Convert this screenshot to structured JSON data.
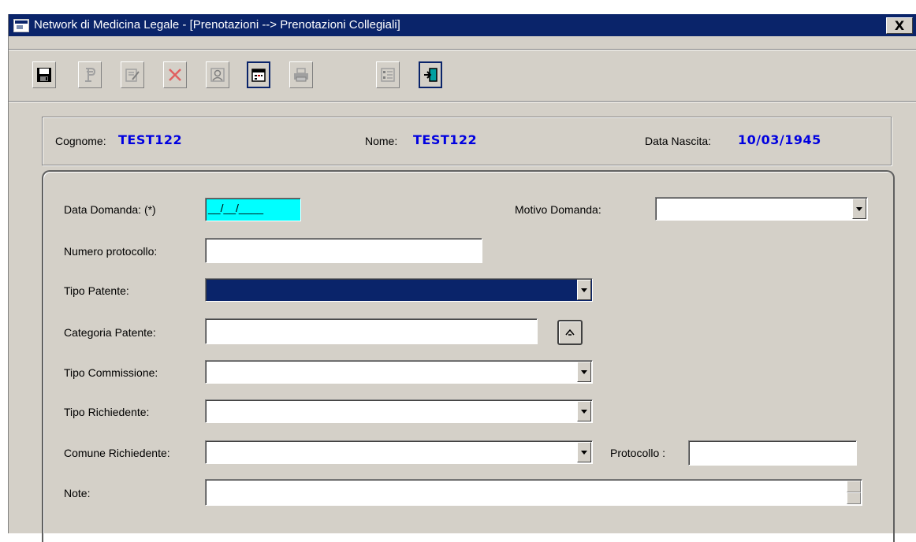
{
  "window": {
    "title": "Network di Medicina Legale - [Prenotazioni --> Prenotazioni Collegiali]",
    "close_label": "X",
    "title_color": "#0a246a"
  },
  "toolbar": {
    "buttons": [
      {
        "name": "save",
        "icon": "floppy-disk-icon",
        "enabled": true
      },
      {
        "name": "p",
        "icon": "p-letter-icon",
        "enabled": false
      },
      {
        "name": "edit",
        "icon": "edit-document-icon",
        "enabled": false
      },
      {
        "name": "delete",
        "icon": "red-x-icon",
        "enabled": false
      },
      {
        "name": "person",
        "icon": "person-card-icon",
        "enabled": false
      },
      {
        "name": "calendar",
        "icon": "calendar-icon",
        "enabled": true
      },
      {
        "name": "print",
        "icon": "printer-icon",
        "enabled": false
      },
      {
        "name": "list",
        "icon": "list-form-icon",
        "enabled": false
      },
      {
        "name": "exit",
        "icon": "exit-door-icon",
        "enabled": true
      }
    ]
  },
  "patient": {
    "cognome_label": "Cognome:",
    "cognome_value": "TEST122",
    "nome_label": "Nome:",
    "nome_value": "TEST122",
    "nascita_label": "Data Nascita:",
    "nascita_value": "10/03/1945",
    "value_color": "#0000e0"
  },
  "form": {
    "data_domanda_label": "Data Domanda: (*)",
    "data_domanda_value": "__/__/____",
    "motivo_label": "Motivo Domanda:",
    "motivo_value": "",
    "numero_protocollo_label": "Numero protocollo:",
    "numero_protocollo_value": "",
    "tipo_patente_label": "Tipo Patente:",
    "tipo_patente_value": "",
    "categoria_label": "Categoria Patente:",
    "categoria_value": "",
    "tipo_commissione_label": "Tipo Commissione:",
    "tipo_commissione_value": "",
    "tipo_richiedente_label": "Tipo Richiedente:",
    "tipo_richiedente_value": "",
    "comune_label": "Comune Richiedente:",
    "comune_value": "",
    "protocollo_label": "Protocollo :",
    "protocollo_value": "",
    "note_label": "Note:",
    "note_value": ""
  }
}
